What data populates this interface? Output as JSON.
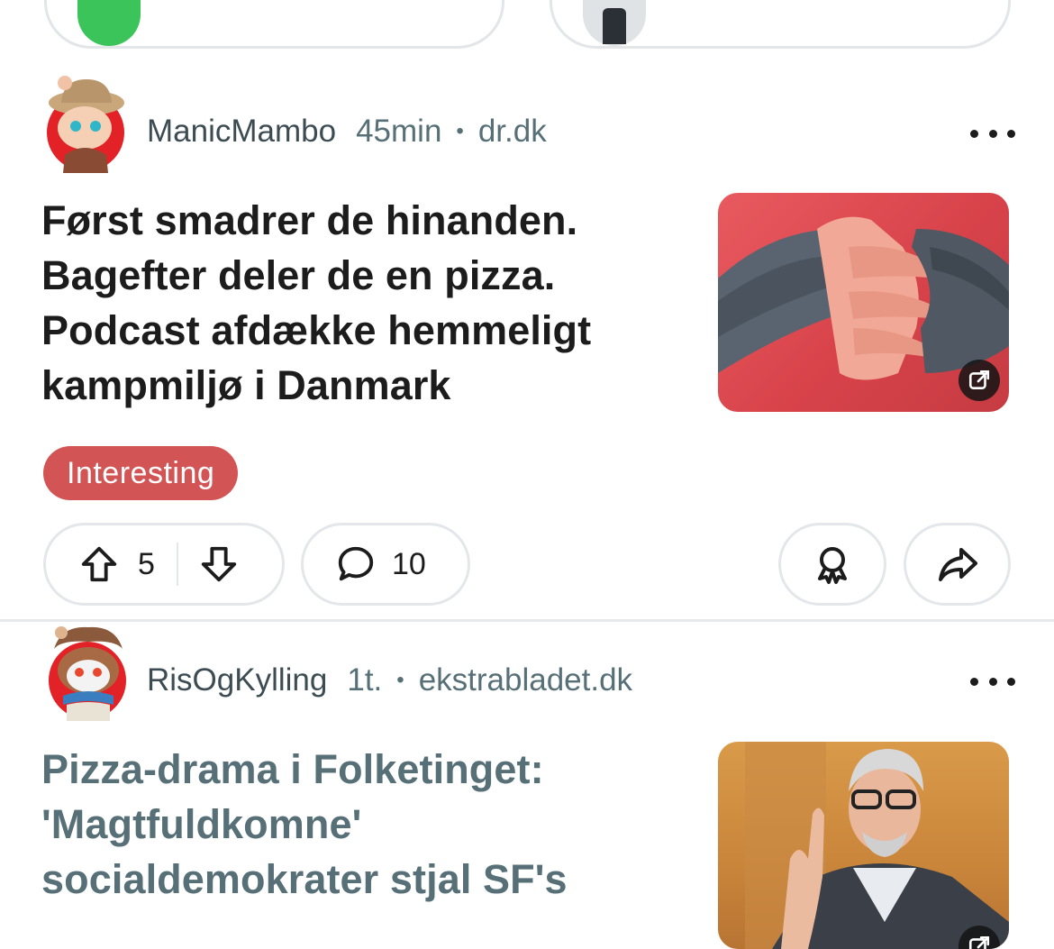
{
  "posts": [
    {
      "username": "ManicMambo",
      "time": "45min",
      "separator": "•",
      "domain": "dr.dk",
      "title": "Først smadrer de hinanden. Bagefter deler de en pizza. Podcast afdække hemmeligt kampmiljø i Danmark",
      "flair": "Interesting",
      "upvotes": "5",
      "comments": "10"
    },
    {
      "username": "RisOgKylling",
      "time": "1t.",
      "separator": "•",
      "domain": "ekstrabladet.dk",
      "title": "Pizza-drama i Folketinget: 'Magtfuldkomne' socialdemokrater stjal SF's"
    }
  ],
  "colors": {
    "flair_bg": "#d35454",
    "meta_text": "#576f76",
    "read_title": "#576f76",
    "border": "#e4e7e9"
  },
  "icons": [
    "more-icon",
    "upvote-icon",
    "downvote-icon",
    "comment-icon",
    "award-icon",
    "share-icon",
    "external-link-icon"
  ]
}
